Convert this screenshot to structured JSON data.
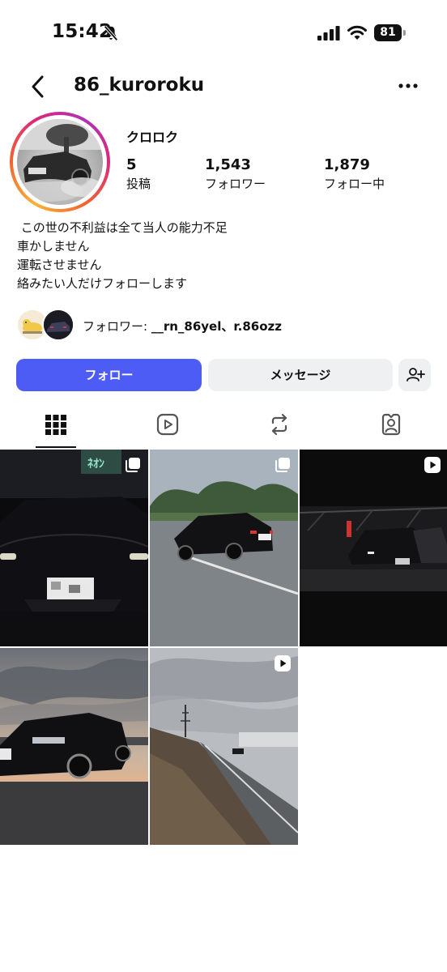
{
  "status_bar": {
    "time": "15:42",
    "battery": "81",
    "icons": [
      "bell-slash-icon",
      "cellular-signal-icon",
      "wifi-icon",
      "battery-icon"
    ]
  },
  "header": {
    "username": "86_kuroroku",
    "icons": [
      "chevron-left-icon",
      "more-horizontal-icon"
    ]
  },
  "profile": {
    "display_name": "クロロク",
    "stats": [
      {
        "value": "5",
        "label": "投稿"
      },
      {
        "value": "1,543",
        "label": "フォロワー"
      },
      {
        "value": "1,879",
        "label": "フォロー中"
      }
    ],
    "bio": [
      " この世の不利益は全て当人の能力不足",
      "車かしません",
      "運転させません",
      "絡みたい人だけフォローします"
    ],
    "mutual_prefix": "フォロワー: ",
    "mutual_names": "__rn_86yel、r.86ozz"
  },
  "actions": {
    "follow": "フォロー",
    "message": "メッセージ",
    "add_user_icon": "person-add-icon"
  },
  "tabs": {
    "items": [
      "grid-icon",
      "reels-icon",
      "reposts-icon",
      "tagged-icon"
    ],
    "active": "grid-icon"
  },
  "posts": [
    {
      "type": "carousel",
      "badge_icon": "carousel-icon"
    },
    {
      "type": "carousel",
      "badge_icon": "carousel-icon"
    },
    {
      "type": "reel",
      "badge_icon": "reel-icon"
    },
    {
      "type": "photo",
      "badge_icon": ""
    },
    {
      "type": "reel",
      "badge_icon": "reel-icon"
    }
  ],
  "colors": {
    "follow_button": "#4d5cf5",
    "secondary_button": "#eff0f2",
    "text": "#111111"
  }
}
